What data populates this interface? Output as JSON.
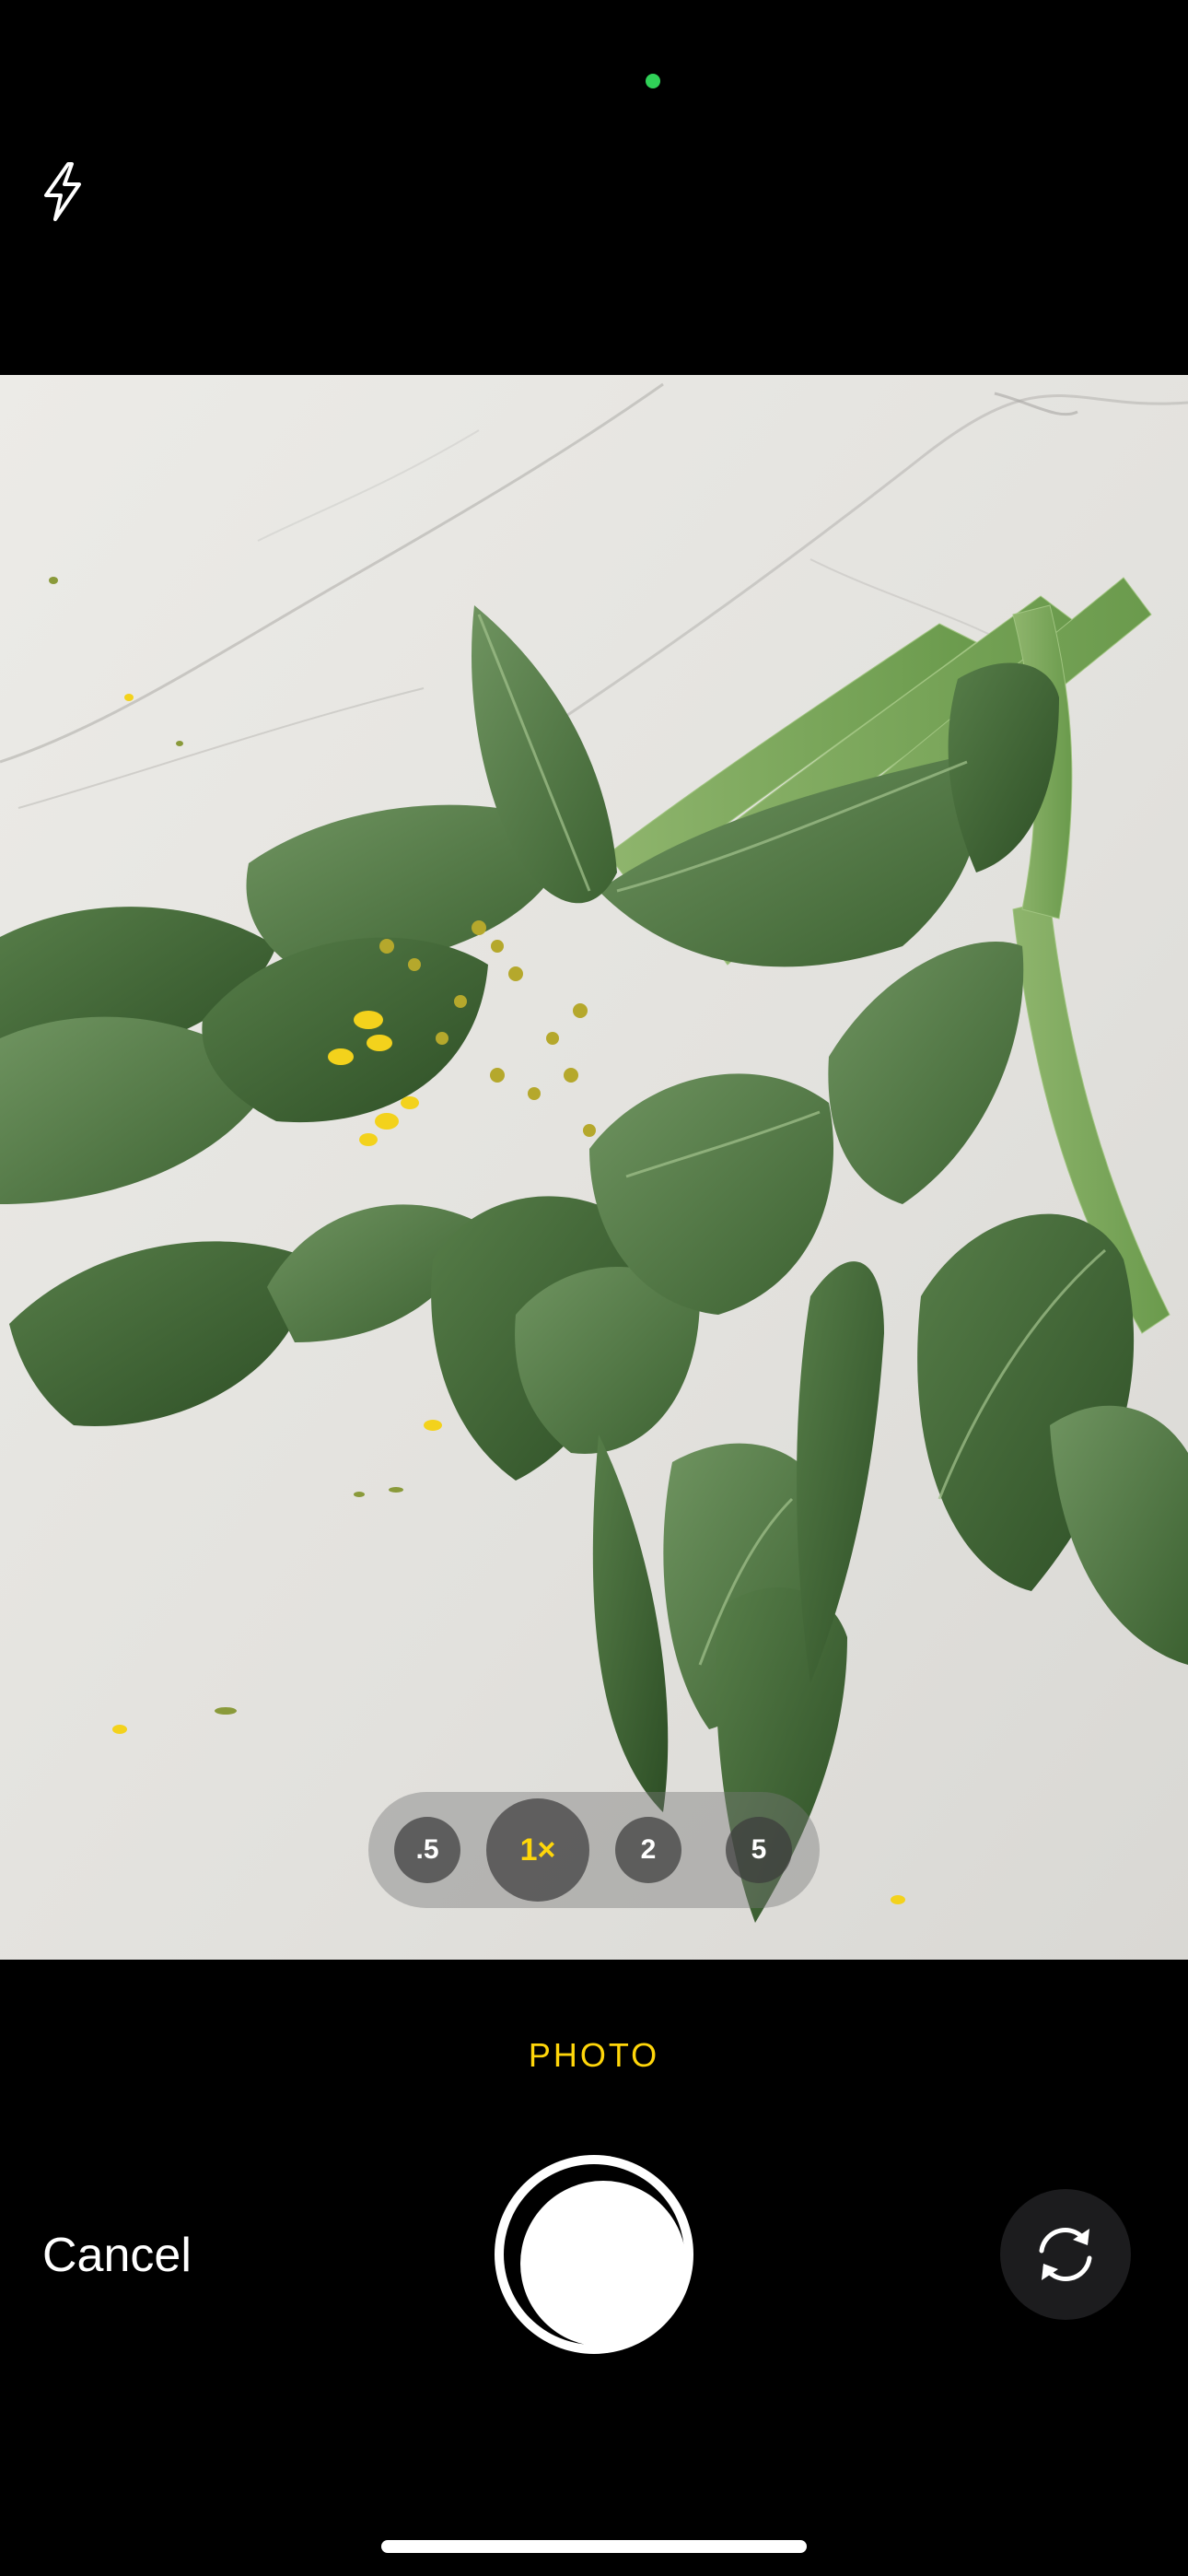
{
  "status": {
    "camera_in_use_indicator_color": "#30D158"
  },
  "toolbar": {
    "flash_icon": "flash-icon"
  },
  "zoom": {
    "options": [
      ".5",
      "1×",
      "2",
      "5"
    ],
    "selected": "1×",
    "selected_color": "#FFD60A"
  },
  "mode": {
    "label": "PHOTO",
    "color": "#FFD60A"
  },
  "controls": {
    "cancel_label": "Cancel",
    "shutter_icon": "shutter-button",
    "flip_icon": "flip-camera-icon"
  }
}
